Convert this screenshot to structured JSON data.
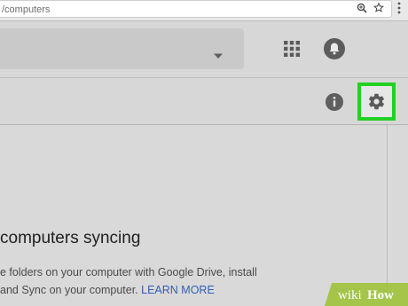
{
  "browser": {
    "url_fragment": "/computers",
    "icons": [
      "zoom-icon",
      "star-icon",
      "more-vert-icon"
    ]
  },
  "header": {
    "icons": [
      "apps-grid-icon",
      "notifications-bell-icon"
    ],
    "search_dropdown_icon": "caret-down-icon"
  },
  "toolbar": {
    "icons": [
      "info-icon",
      "settings-gear-icon"
    ],
    "highlight_color": "#23d123"
  },
  "main": {
    "headline": "computers syncing",
    "description_line1": "e folders on your computer with Google Drive, install",
    "description_line2": "and Sync on your computer.",
    "learn_more": "LEARN MORE",
    "link_color": "#2f5fb0"
  },
  "watermark": {
    "text_wiki": "wiki",
    "text_how": "How"
  }
}
